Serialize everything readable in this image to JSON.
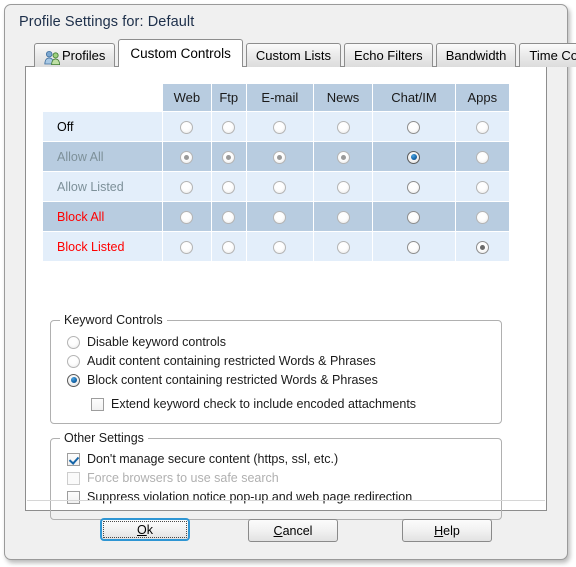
{
  "window": {
    "title": "Profile Settings for: Default"
  },
  "tabs": [
    {
      "label": "Profiles",
      "icon": "users-icon",
      "active": false
    },
    {
      "label": "Custom Controls",
      "icon": null,
      "active": true
    },
    {
      "label": "Custom Lists",
      "icon": null,
      "active": false
    },
    {
      "label": "Echo Filters",
      "icon": null,
      "active": false
    },
    {
      "label": "Bandwidth",
      "icon": null,
      "active": false
    },
    {
      "label": "Time Controls",
      "icon": null,
      "active": false
    }
  ],
  "matrix": {
    "columns": [
      "Web",
      "Ftp",
      "E-mail",
      "News",
      "Chat/IM",
      "Apps"
    ],
    "rows": [
      {
        "label": "Off",
        "label_color": "#000000",
        "band": "light",
        "states": [
          "off",
          "off",
          "off",
          "off",
          "off-emph",
          "off"
        ]
      },
      {
        "label": "Allow All",
        "label_color": "#7d9099",
        "band": "dark",
        "states": [
          "selected-gray",
          "selected-gray",
          "selected-gray",
          "selected-gray",
          "selected-blue",
          "off"
        ]
      },
      {
        "label": "Allow Listed",
        "label_color": "#7d9099",
        "band": "light",
        "states": [
          "off",
          "off",
          "off",
          "off",
          "off-emph",
          "off"
        ]
      },
      {
        "label": "Block All",
        "label_color": "#ff0000",
        "band": "dark",
        "states": [
          "off",
          "off",
          "off",
          "off",
          "off-emph",
          "off"
        ]
      },
      {
        "label": "Block Listed",
        "label_color": "#ff0000",
        "band": "light",
        "states": [
          "off",
          "off",
          "off",
          "off",
          "off-emph",
          "selected-dark"
        ]
      }
    ]
  },
  "keyword_controls": {
    "title": "Keyword Controls",
    "options": [
      {
        "label": "Disable keyword controls",
        "selected": false
      },
      {
        "label": "Audit content containing restricted Words & Phrases",
        "selected": false
      },
      {
        "label": "Block content containing restricted Words & Phrases",
        "selected": true
      }
    ],
    "sub_option": {
      "label": "Extend keyword check to include encoded attachments",
      "checked": false,
      "disabled": false
    }
  },
  "other_settings": {
    "title": "Other Settings",
    "options": [
      {
        "label": "Don't manage secure content (https, ssl, etc.)",
        "checked": true,
        "disabled": false
      },
      {
        "label": "Force browsers to use safe search",
        "checked": false,
        "disabled": true
      },
      {
        "label": "Suppress violation notice pop-up and web page redirection",
        "checked": false,
        "disabled": false
      }
    ]
  },
  "buttons": {
    "ok": {
      "label": "Ok",
      "mnemonic": "O",
      "focused": true
    },
    "cancel": {
      "label": "Cancel",
      "mnemonic": "C",
      "focused": false
    },
    "help": {
      "label": "Help",
      "mnemonic": "H",
      "focused": false
    }
  },
  "colors": {
    "window_bg": "#f0f0f0",
    "panel_bg": "#ffffff",
    "band_dark": "#b8cce0",
    "band_light": "#e3eefa",
    "header_bg": "#b8cce0",
    "accent_blue": "#1565a8",
    "focus_border": "#2e95d3",
    "title_text": "#1d2f4a"
  }
}
